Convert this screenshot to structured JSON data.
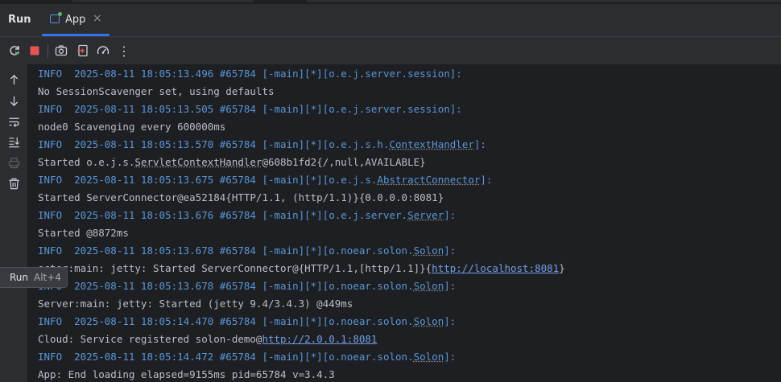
{
  "header": {
    "run_title": "Run",
    "tab": {
      "label": "App",
      "close": "×"
    }
  },
  "toolbar": {
    "buttons": [
      "rerun-icon",
      "stop-icon",
      "camera-icon",
      "exit-icon",
      "gauge-icon",
      "more-vertical-icon"
    ],
    "more_glyph": "⋮"
  },
  "gutter": {
    "buttons": [
      "arrow-up-icon",
      "arrow-down-icon",
      "soft-wrap-icon",
      "scroll-to-end-icon",
      "print-icon",
      "trash-icon"
    ]
  },
  "tooltip": {
    "label": "Run",
    "shortcut": "Alt+4"
  },
  "colors": {
    "info": "#5896d8",
    "link": "#6f9ee6",
    "accent": "#3574f0",
    "stop": "#e55452"
  },
  "log": [
    {
      "type": "info",
      "prefix": "INFO  2025-08-11 18:05:13.496 #65784 [-main][*][o.e.j.server.session]:",
      "ul": "",
      "suffix": ""
    },
    {
      "type": "msg",
      "a": "No SessionScavenger set, using defaults",
      "u": "",
      "b": "",
      "link": "",
      "c": ""
    },
    {
      "type": "info",
      "prefix": "INFO  2025-08-11 18:05:13.505 #65784 [-main][*][o.e.j.server.session]:",
      "ul": "",
      "suffix": ""
    },
    {
      "type": "msg",
      "a": "node0 Scavenging every 600000ms",
      "u": "",
      "b": "",
      "link": "",
      "c": ""
    },
    {
      "type": "info",
      "prefix": "INFO  2025-08-11 18:05:13.570 #65784 [-main][*][o.e.j.s.h.",
      "ul": "ContextHandler",
      "suffix": "]:"
    },
    {
      "type": "msg",
      "a": "Started o.e.j.s.",
      "u": "ServletContextHandler",
      "b": "@608b1fd2{/,null,AVAILABLE}",
      "link": "",
      "c": ""
    },
    {
      "type": "info",
      "prefix": "INFO  2025-08-11 18:05:13.675 #65784 [-main][*][o.e.j.s.",
      "ul": "AbstractConnector",
      "suffix": "]:"
    },
    {
      "type": "msg",
      "a": "Started ServerConnector@ea52184{HTTP/1.1, (http/1.1)}{0.0.0.0:8081}",
      "u": "",
      "b": "",
      "link": "",
      "c": ""
    },
    {
      "type": "info",
      "prefix": "INFO  2025-08-11 18:05:13.676 #65784 [-main][*][o.e.j.server.",
      "ul": "Server",
      "suffix": "]:"
    },
    {
      "type": "msg",
      "a": "Started @8872ms",
      "u": "",
      "b": "",
      "link": "",
      "c": ""
    },
    {
      "type": "info",
      "prefix": "INFO  2025-08-11 18:05:13.678 #65784 [-main][*][o.noear.solon.",
      "ul": "Solon",
      "suffix": "]:"
    },
    {
      "type": "msg",
      "a": "ector:main: jetty: Started ServerConnector@{HTTP/1.1,[http/1.1]}{",
      "u": "",
      "b": "",
      "link": "http://localhost:8081",
      "c": "}"
    },
    {
      "type": "info",
      "prefix": "INFO  2025-08-11 18:05:13.678 #65784 [-main][*][o.noear.solon.",
      "ul": "Solon",
      "suffix": "]:"
    },
    {
      "type": "msg",
      "a": "Server:main: jetty: Started (jetty 9.4/3.4.3) @449ms",
      "u": "",
      "b": "",
      "link": "",
      "c": ""
    },
    {
      "type": "info",
      "prefix": "INFO  2025-08-11 18:05:14.470 #65784 [-main][*][o.noear.solon.",
      "ul": "Solon",
      "suffix": "]:"
    },
    {
      "type": "msg",
      "a": "Cloud: Service registered solon-demo@",
      "u": "",
      "b": "",
      "link": "http://2.0.0.1:8081",
      "c": ""
    },
    {
      "type": "info",
      "prefix": "INFO  2025-08-11 18:05:14.472 #65784 [-main][*][o.noear.solon.",
      "ul": "Solon",
      "suffix": "]:"
    },
    {
      "type": "msg",
      "a": "App: End loading elapsed=9155ms pid=65784 v=3.4.3",
      "u": "",
      "b": "",
      "link": "",
      "c": ""
    }
  ]
}
